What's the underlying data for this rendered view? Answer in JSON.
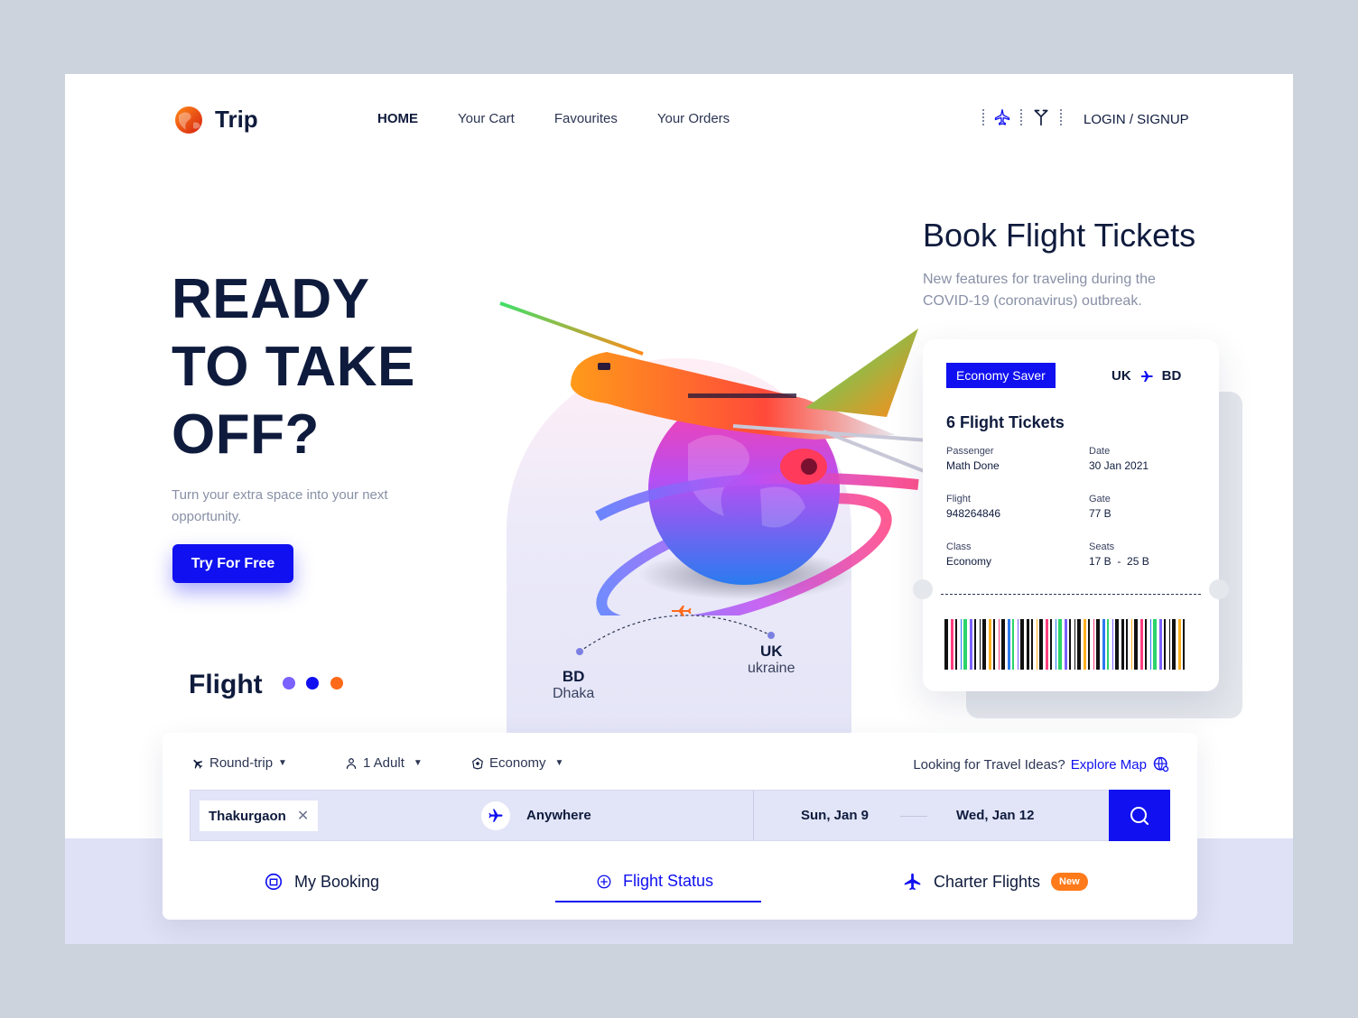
{
  "brand": {
    "name": "Trip"
  },
  "nav": {
    "items": [
      "HOME",
      "Your Cart",
      "Favourites",
      "Your Orders"
    ]
  },
  "auth": {
    "label": "LOGIN / SIGNUP"
  },
  "hero": {
    "title_lines": [
      "READY",
      "TO TAKE",
      "OFF?"
    ],
    "subtitle": "Turn your extra space into your next opportunity.",
    "cta": "Try For Free",
    "flight_label": "Flight",
    "dot_colors": [
      "#7b61ff",
      "#1010f0",
      "#ff6a1a"
    ]
  },
  "route": {
    "from": {
      "code": "BD",
      "name": "Dhaka"
    },
    "to": {
      "code": "UK",
      "name": "ukraine"
    }
  },
  "booking": {
    "title": "Book Flight Tickets",
    "subtitle": "New features for traveling during the COVID-19 (coronavirus) outbreak."
  },
  "ticket": {
    "badge": "Economy Saver",
    "from": "UK",
    "to": "BD",
    "count": "6 Flight Tickets",
    "passenger_label": "Passenger",
    "passenger": "Math Done",
    "date_label": "Date",
    "date": "30 Jan 2021",
    "flight_label": "Flight",
    "flight": "948264846",
    "gate_label": "Gate",
    "gate": "77 B",
    "class_label": "Class",
    "class": "Economy",
    "seats_label": "Seats",
    "seats": "17 B  -  25 B"
  },
  "search": {
    "trip_type": "Round-trip",
    "passengers": "1 Adult",
    "cabin": "Economy",
    "ideas_text": "Looking for Travel Ideas?",
    "explore_link": "Explore Map",
    "from_value": "Thakurgaon",
    "to_value": "Anywhere",
    "depart": "Sun, Jan 9",
    "return": "Wed, Jan 12"
  },
  "tabs": {
    "my_booking": "My Booking",
    "flight_status": "Flight Status",
    "charter": "Charter Flights",
    "new_badge": "New"
  },
  "colors": {
    "accent": "#1010f0",
    "orange": "#ff7a1a",
    "navy": "#0f1b3d"
  }
}
